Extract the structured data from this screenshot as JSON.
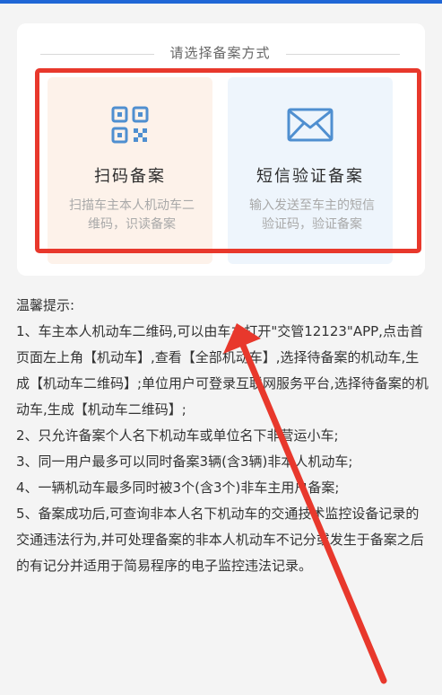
{
  "card": {
    "title": "请选择备案方式"
  },
  "options": [
    {
      "name": "扫码备案",
      "description": "扫描车主本人机动车二维码，识读备案",
      "icon": "qr-code-icon",
      "background": "#fdf2ea"
    },
    {
      "name": "短信验证备案",
      "description": "输入发送至车主的短信验证码，验证备案",
      "icon": "envelope-icon",
      "background": "#eef5fc"
    }
  ],
  "tips": {
    "heading": "温馨提示:",
    "items": [
      "1、车主本人机动车二维码,可以由车主打开\"交管12123\"APP,点击首页面左上角【机动车】,查看【全部机动车】,选择待备案的机动车,生成【机动车二维码】;单位用户可登录互联网服务平台,选择待备案的机动车,生成【机动车二维码】;",
      "2、只允许备案个人名下机动车或单位名下非营运小车;",
      "3、同一用户最多可以同时备案3辆(含3辆)非本人机动车;",
      "4、一辆机动车最多同时被3个(含3个)非车主用户备案;",
      "5、备案成功后,可查询非本人名下机动车的交通技术监控设备记录的交通违法行为,并可处理备案的非本人机动车不记分或发生于备案之后的有记分并适用于简易程序的电子监控违法记录。"
    ]
  },
  "colors": {
    "accent_blue": "#1f66d6",
    "icon_blue": "#4f8fd0",
    "annotation_red": "#e8382c"
  }
}
